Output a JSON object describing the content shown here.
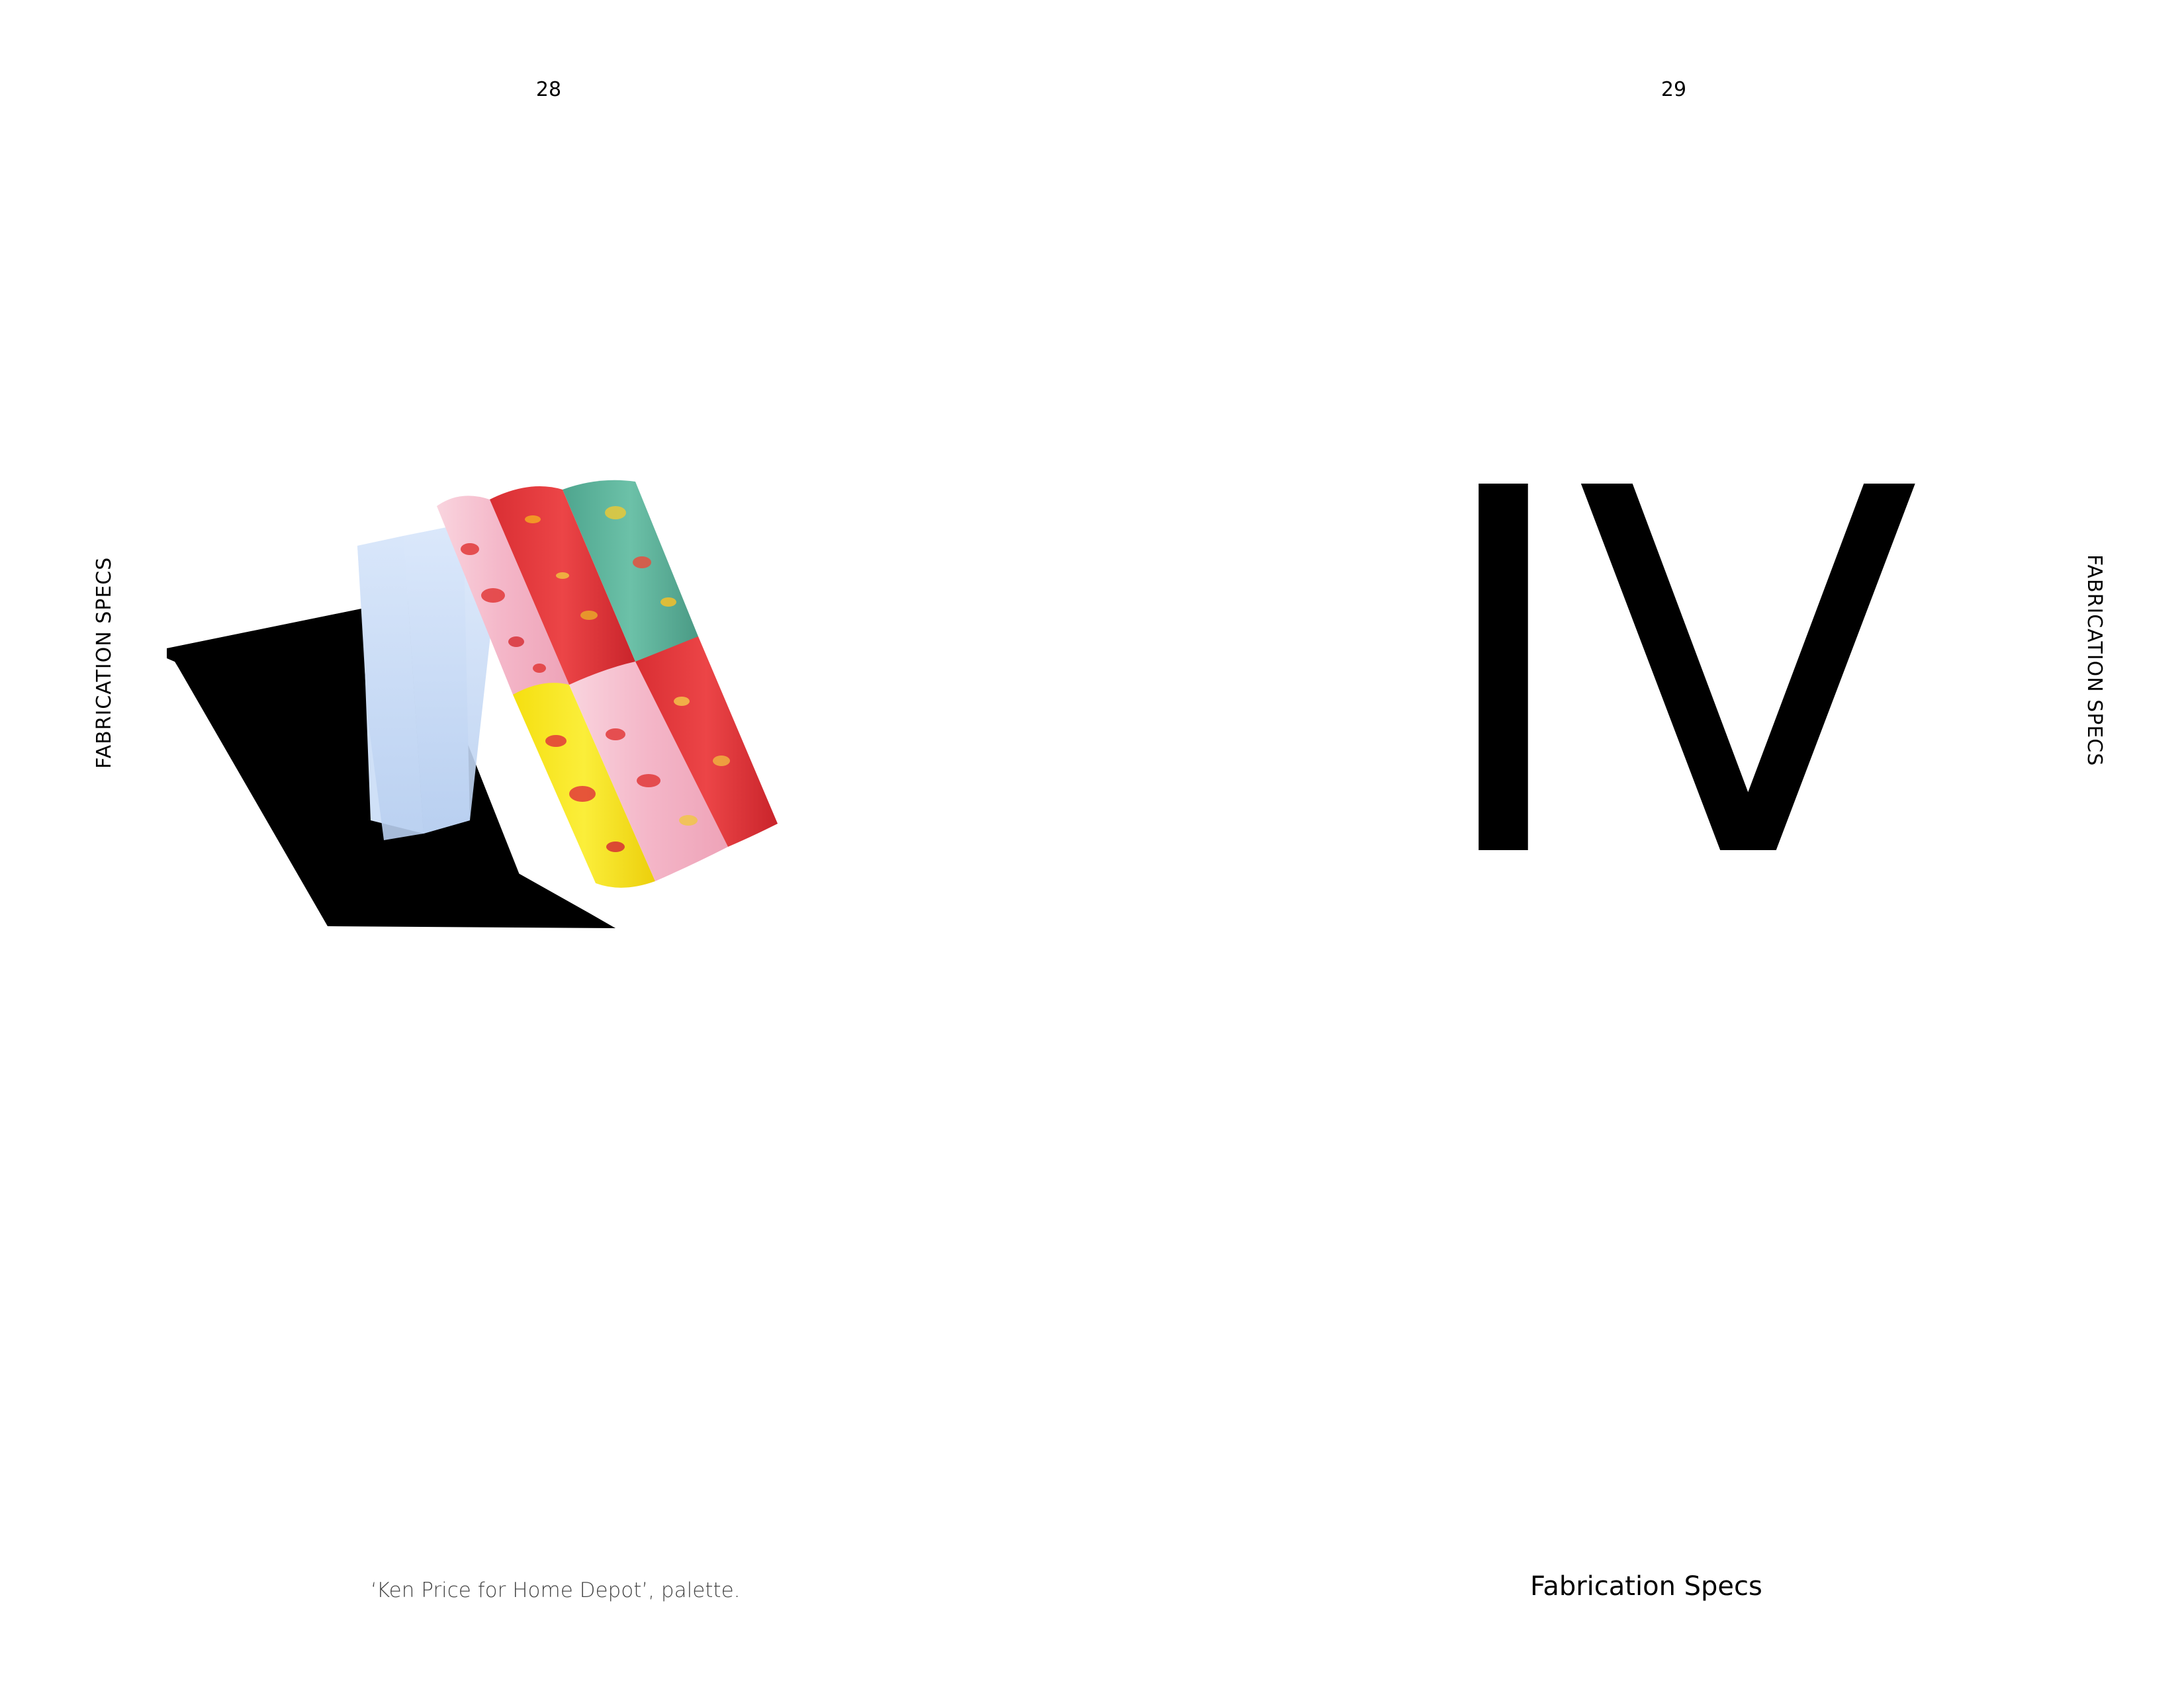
{
  "left_page": {
    "page_number": "28",
    "running_head": "FABRICATION SPECS",
    "caption": "‘Ken Price for Home Depot’, palette.",
    "photo_palette": {
      "pink": "#f4b6c8",
      "red": "#e23a3a",
      "teal": "#5fb59d",
      "yellow": "#f7e81e",
      "foam_block": "#c9dcf5",
      "shadow": "#000000"
    }
  },
  "right_page": {
    "page_number": "29",
    "running_head": "FABRICATION SPECS",
    "section_numeral": "IV",
    "section_title": "Fabrication Specs"
  }
}
